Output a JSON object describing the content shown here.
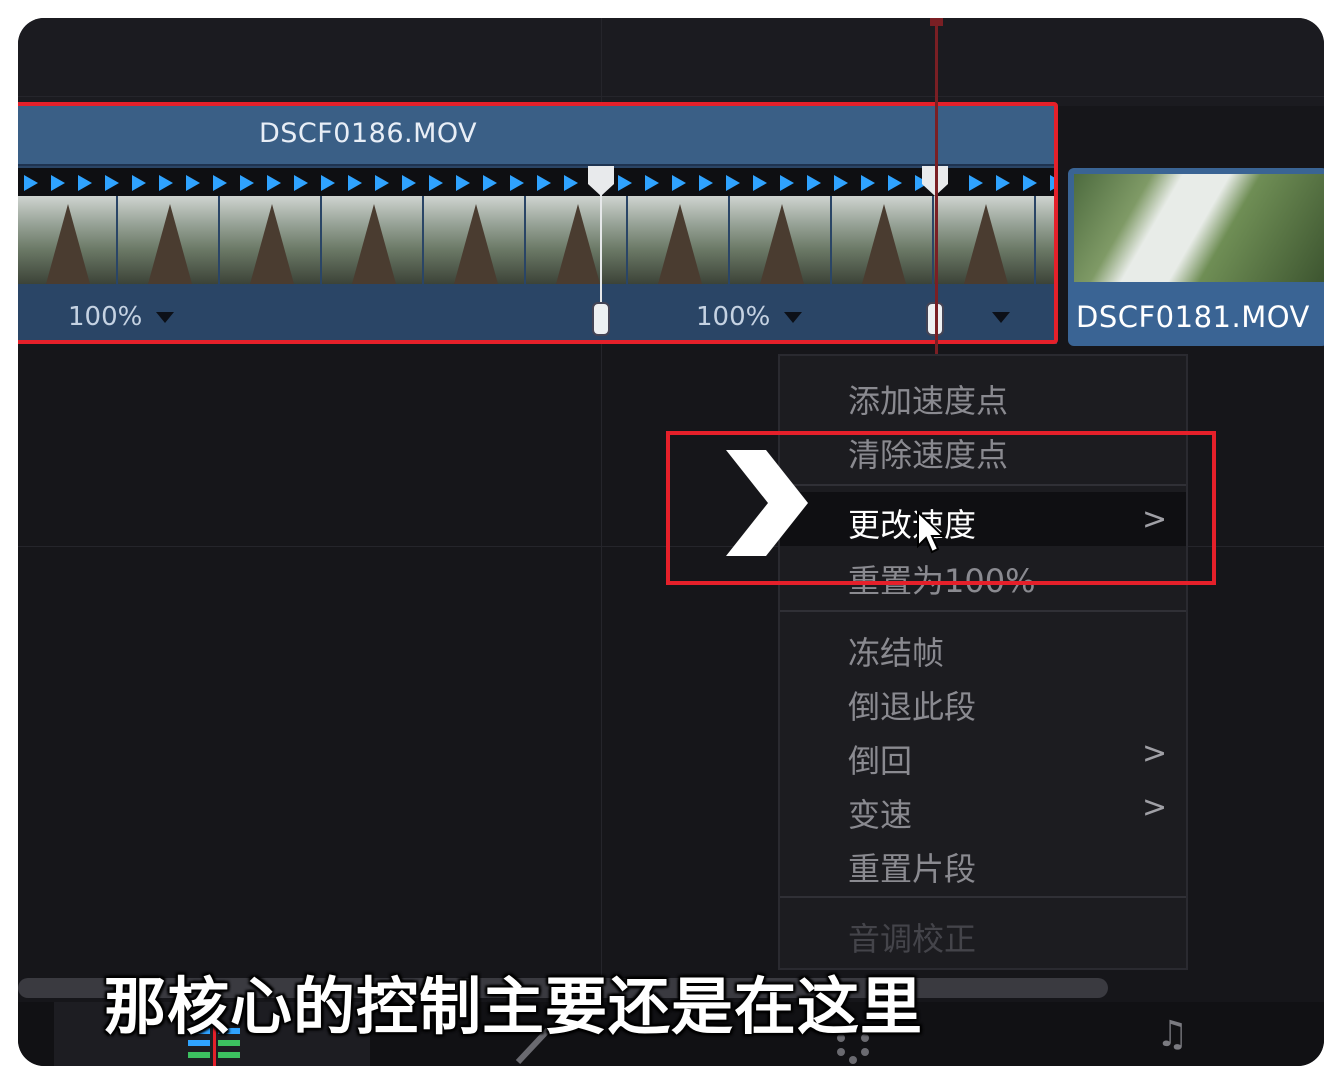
{
  "timeline": {
    "main_clip": {
      "name": "DSCF0186.MOV",
      "segments": [
        {
          "speed": "100%"
        },
        {
          "speed": "100%"
        },
        {
          "speed": ""
        }
      ]
    },
    "second_clip": {
      "name": "DSCF0181.MOV"
    }
  },
  "context_menu": {
    "items": [
      {
        "label": "添加速度点",
        "state": "normal",
        "submenu": false
      },
      {
        "label": "清除速度点",
        "state": "normal",
        "submenu": false
      },
      {
        "label": "更改速度",
        "state": "highlighted",
        "submenu": true
      },
      {
        "label": "重置为100%",
        "state": "normal",
        "submenu": false
      },
      {
        "label": "冻结帧",
        "state": "normal",
        "submenu": false
      },
      {
        "label": "倒退此段",
        "state": "normal",
        "submenu": false
      },
      {
        "label": "倒回",
        "state": "normal",
        "submenu": true
      },
      {
        "label": "变速",
        "state": "normal",
        "submenu": true
      },
      {
        "label": "重置片段",
        "state": "normal",
        "submenu": false
      },
      {
        "label": "音调校正",
        "state": "disabled",
        "submenu": false
      }
    ],
    "submenu_glyph": ">"
  },
  "subtitle": "那核心的控制主要还是在这里",
  "bottom_bar": {
    "music_icon_glyph": "♫"
  },
  "colors": {
    "highlight_box": "#e5202a",
    "clip_blue": "#3a5f86",
    "speed_arrow": "#2fa3ff"
  }
}
